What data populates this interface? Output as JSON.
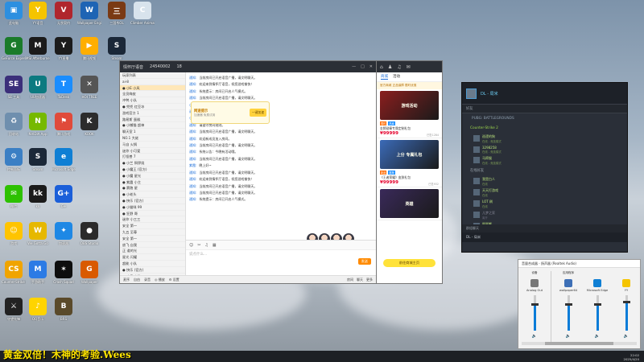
{
  "desktop": {
    "icons": [
      {
        "label": "此电脑",
        "color": "#2d8fe0",
        "glyph": "▣"
      },
      {
        "label": "YY语音",
        "color": "#f5c400",
        "glyph": "Y"
      },
      {
        "label": "无畏契约",
        "color": "#b0262d",
        "glyph": "V"
      },
      {
        "label": "Wallpaper Engine",
        "color": "#1e64b4",
        "glyph": "W"
      },
      {
        "label": "三国杀OL",
        "color": "#7a3a14",
        "glyph": "三"
      },
      {
        "label": "Climber Animals",
        "color": "#d8e3ec",
        "glyph": "C"
      },
      {
        "label": "GeForce Experience",
        "color": "#1a7b2a",
        "glyph": "G"
      },
      {
        "label": "MSI Afterburner",
        "color": "#1b1b1b",
        "glyph": "M"
      },
      {
        "label": "YY直播",
        "color": "#1c1c1c",
        "glyph": "Y"
      },
      {
        "label": "腾讯视频",
        "color": "#ffae00",
        "glyph": "▶"
      },
      {
        "label": "Steam",
        "color": "#1b2838",
        "glyph": "S"
      },
      {
        "label": "SE 工具",
        "color": "#3b2f7a",
        "glyph": "SE"
      },
      {
        "label": "UU加速器",
        "color": "#0c7a80",
        "glyph": "U"
      },
      {
        "label": "ToDesk",
        "color": "#1a8dff",
        "glyph": "T"
      },
      {
        "label": "HOI TREE",
        "color": "#555",
        "glyph": "✕"
      },
      {
        "label": "回收站",
        "color": "#6f8fae",
        "glyph": "♻"
      },
      {
        "label": "NVIDIA App",
        "color": "#76b900",
        "glyph": "N"
      },
      {
        "label": "腾讯游戏",
        "color": "#e04a3a",
        "glyph": "⚑"
      },
      {
        "label": "KOOK",
        "color": "#2c2c2c",
        "glyph": "K"
      },
      {
        "label": "控制面板",
        "color": "#3b7fc4",
        "glyph": "⚙"
      },
      {
        "label": "Steam",
        "color": "#1b2838",
        "glyph": "S"
      },
      {
        "label": "Microsoft Edge",
        "color": "#0f7fd4",
        "glyph": "e"
      },
      {
        "label": "微信",
        "color": "#2dc100",
        "glyph": "✉"
      },
      {
        "label": "kk",
        "color": "#1b1b1b",
        "glyph": "kk"
      },
      {
        "label": "G+",
        "color": "#1b5fd9",
        "glyph": "G+"
      },
      {
        "label": "游戏",
        "color": "#ffc400",
        "glyph": "☺"
      },
      {
        "label": "We Gotta Go",
        "color": "#e6b800",
        "glyph": "W"
      },
      {
        "label": "加速器",
        "color": "#1e88e5",
        "glyph": "✦"
      },
      {
        "label": "OBS Studio",
        "color": "#2b2b2b",
        "glyph": "●"
      },
      {
        "label": "Counter-Strike 2",
        "color": "#f0a400",
        "glyph": "CS"
      },
      {
        "label": "手游助手",
        "color": "#2c7be5",
        "glyph": "M"
      },
      {
        "label": "Crash Squad",
        "color": "#0e0e0e",
        "glyph": "✶"
      },
      {
        "label": "Wallpaper",
        "color": "#d95a00",
        "glyph": "G"
      },
      {
        "label": "守望先锋",
        "color": "#222",
        "glyph": "⚔"
      },
      {
        "label": "QQ音乐",
        "color": "#ffd400",
        "glyph": "♪"
      },
      {
        "label": "BRS",
        "color": "#5a4a2a",
        "glyph": "B"
      }
    ]
  },
  "chat": {
    "title": "情怀厅语音",
    "room_id": "24540002",
    "online": "18",
    "members": [
      "玩家列表",
      "ai-8",
      "● 小E 小风",
      "全员嗨皮",
      "冲鸭 小队",
      "● 兜兜 红豆冰",
      "游戏官方 1",
      "路易斯 蛋糕",
      "● 小懒猫 超神",
      "聊天室 1",
      "NO.1 大佬",
      "马自 火锅",
      "迷你 小可爱",
      "打怪兽 7",
      "● 小兰 铜锣烧",
      "● 小魔王 (官方)",
      "● 小魔 星光",
      "● 紫霞 小主",
      "● 赛跑 星",
      "● 小老头",
      "● 快乐 (官方)",
      "● 小猫咪 99",
      "● 狂野 哥",
      "迷你 小三三",
      "安全 第一",
      "九五 至尊",
      "安全 第一",
      "放飞 自我",
      "正 道的光",
      "星光 闪耀",
      "超能 小队",
      "● 快乐 (官方)",
      "● 欢乐 小队",
      "ey1 1",
      "ey1 2",
      "ey1 3",
      "ey1 4",
      "ey1 5"
    ],
    "messages": [
      {
        "name": "通知:",
        "text": "当前房间已开启语音广播，请文明聊天。"
      },
      {
        "name": "通知:",
        "text": "欢迎来到情怀厅语音，祝您游戏愉快！"
      },
      {
        "name": "通知:",
        "text": "系统提示：房间已开启人气模式。"
      },
      {
        "name": "通知:",
        "text": "当前房间已开启语音广播，请文明聊天。"
      },
      {
        "name": "小兰:",
        "text": "大家好呀~"
      },
      {
        "name": "通知:",
        "text": "当前房间已开启语音广播，请文明聊天。"
      },
      {
        "name": "小魔王:",
        "text": "来来来开黑了！"
      },
      {
        "name": "通知:",
        "text": "请遵守房间规则。"
      },
      {
        "name": "通知:",
        "text": "当前房间已开启语音广播，请文明聊天。"
      },
      {
        "name": "通知:",
        "text": "欢迎新成员加入房间。"
      },
      {
        "name": "通知:",
        "text": "当前房间已开启语音广播，请文明聊天。"
      },
      {
        "name": "通知:",
        "text": "系统公告：今晚有活动哦。"
      },
      {
        "name": "通知:",
        "text": "当前房间已开启语音广播，请文明聊天。"
      },
      {
        "name": "紫霞:",
        "text": "晚上好~"
      },
      {
        "name": "通知:",
        "text": "当前房间已开启语音广播，请文明聊天。"
      },
      {
        "name": "通知:",
        "text": "欢迎来到情怀厅语音，祝您游戏愉快！"
      },
      {
        "name": "通知:",
        "text": "当前房间已开启语音广播，请文明聊天。"
      },
      {
        "name": "通知:",
        "text": "当前房间已开启语音广播，请文明聊天。"
      },
      {
        "name": "通知:",
        "text": "系统提示：房间已开启人气模式。"
      }
    ],
    "ad": {
      "title": "网速提示",
      "subtitle": "加速器 免费试用",
      "button": "一键加速"
    },
    "toolbar": [
      "☺",
      "✂",
      "♫",
      "▦"
    ],
    "input_placeholder": "说点什么...",
    "send_label": "发送",
    "bottom": [
      "麦序",
      "自由",
      "录音",
      "◎ 播放",
      "⚙ 设置"
    ],
    "bottom_right": [
      "房间",
      "聊天",
      "更多"
    ]
  },
  "mall": {
    "tabs": [
      "商城",
      "活动"
    ],
    "notice": "官方商城 正品保障 限时优惠",
    "products": [
      {
        "img": "游戏活动",
        "color": "#8a1e1e",
        "tags": [
          "限时",
          "热卖"
        ],
        "name": "金牌勋章专属定制礼包",
        "price": "¥99999",
        "sold": "已售1284"
      },
      {
        "img": "上分 专属礼包",
        "color": "#3b6bb8",
        "tags": [
          "新品",
          "推荐"
        ],
        "name": "《王者荣耀》皮肤礼包",
        "price": "¥99999",
        "sold": "已售932"
      },
      {
        "img": "英雄",
        "color": "#3a2a5a",
        "tags": [],
        "name": "",
        "price": "",
        "sold": ""
      }
    ],
    "button": "前往商城主页"
  },
  "steam": {
    "name": "DL - 局米",
    "friends_label": "好友",
    "game": "PUBG: BATTLEGROUNDS",
    "group1": "Counter-Strike 2",
    "friends_ingame": [
      {
        "name": "巡逻的狗",
        "status": "在线 - 竞技模式"
      },
      {
        "name": "3298258",
        "status": "在线 - 竞技模式"
      },
      {
        "name": "马蹄猴",
        "status": "在线 - 竞技模式"
      }
    ],
    "group2": "在线好友",
    "friends_online": [
      {
        "name": "我是白人",
        "status": "在线"
      },
      {
        "name": "天天打游戏",
        "status": "在线"
      },
      {
        "name": "LOT 刷",
        "status": "在线"
      },
      {
        "name": "儿梦之家",
        "status": "离开"
      },
      {
        "name": "胖胖熊",
        "status": "在线"
      }
    ],
    "chat_header": "群组聊天",
    "chat_row": "DL - 局米"
  },
  "mixer": {
    "title": "音量合成器 - 扬声器 (Realtek Audio)",
    "columns": [
      {
        "head": "设备",
        "name": "Analog Out",
        "color": "#777",
        "level": 0.72
      },
      {
        "head": "应用程序",
        "name": "wallpaper64",
        "color": "#3d6fb6",
        "level": 0.72
      },
      {
        "head": "",
        "name": "Microsoft Edge",
        "color": "#0f7fd4",
        "level": 0.72
      },
      {
        "head": "",
        "name": "YY",
        "color": "#f5c400",
        "level": 0.8
      }
    ]
  },
  "taskbar": {
    "marquee": "黄金双倍！木神的考验.Wees",
    "time": "22:02",
    "date": "2025/4/20"
  }
}
